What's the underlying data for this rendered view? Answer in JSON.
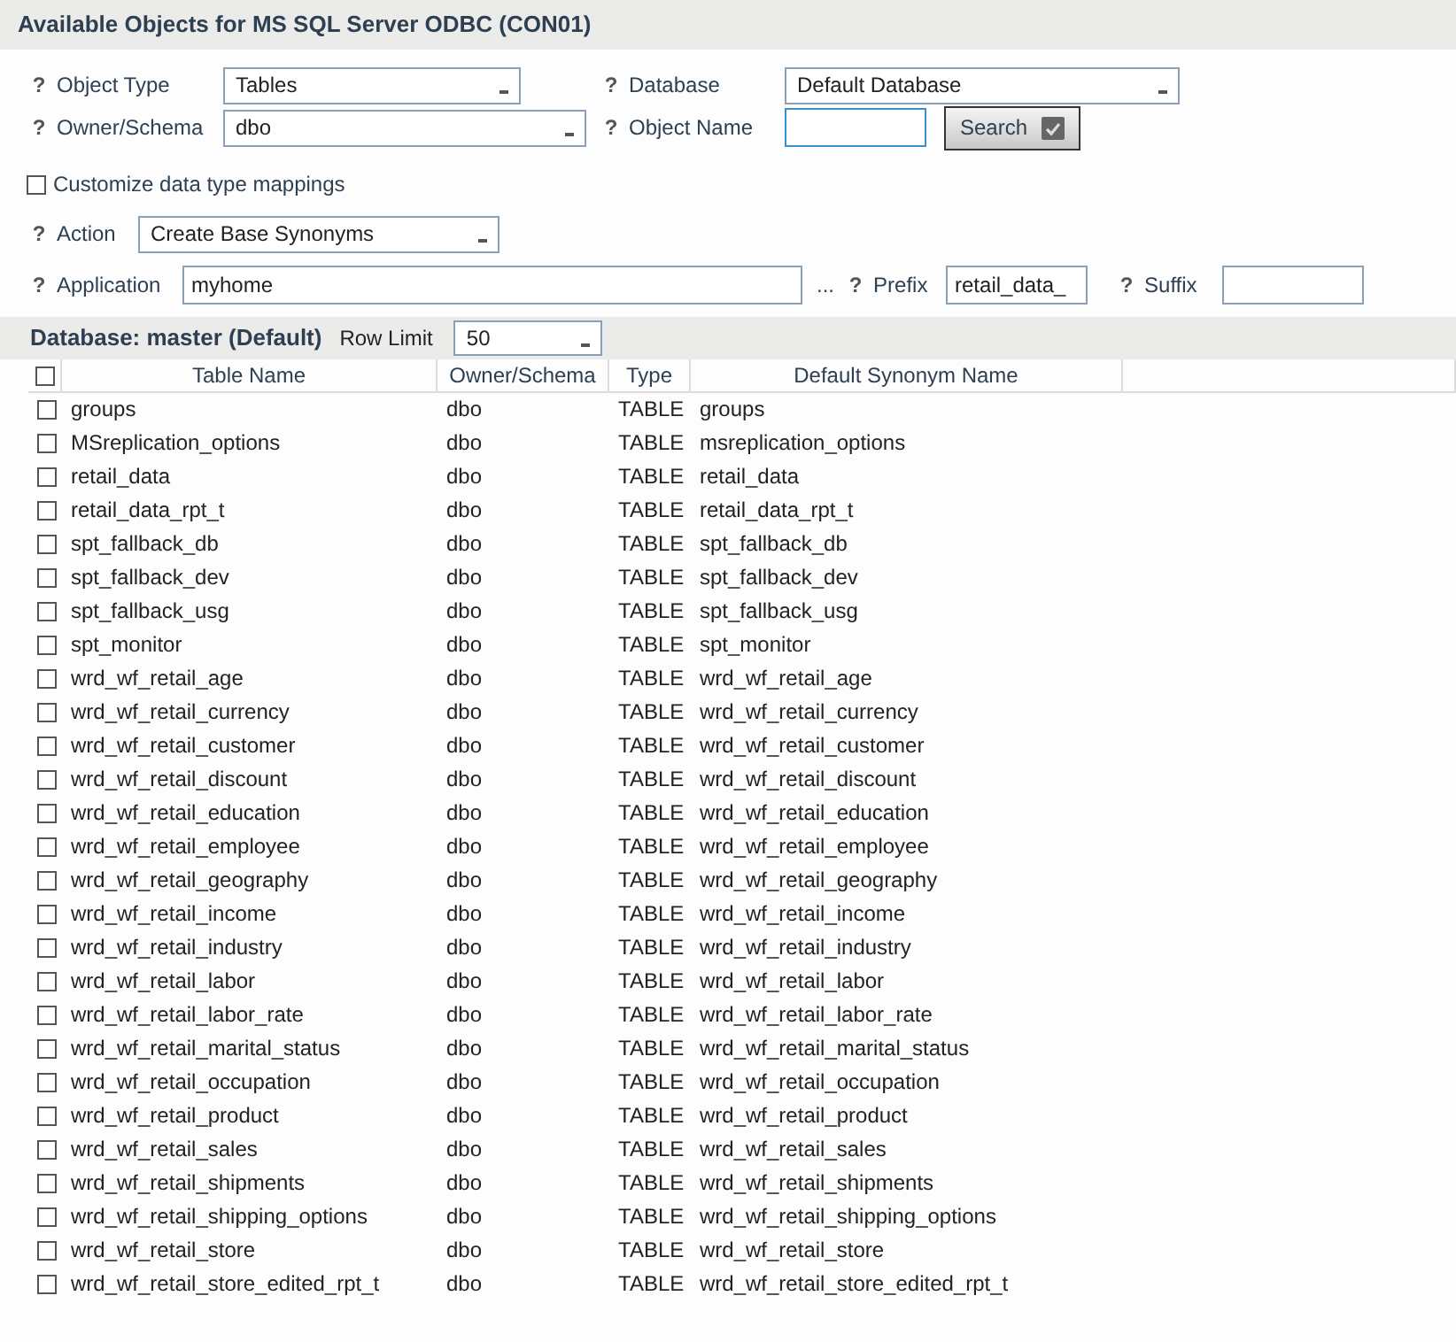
{
  "title": "Available Objects for MS SQL Server ODBC (CON01)",
  "form": {
    "help": "?",
    "object_type": {
      "label": "Object Type",
      "value": "Tables"
    },
    "database": {
      "label": "Database",
      "value": "Default Database"
    },
    "owner_schema": {
      "label": "Owner/Schema",
      "value": "dbo"
    },
    "object_name": {
      "label": "Object Name"
    },
    "search_button": {
      "label": "Search"
    },
    "customize": {
      "label": "Customize data type mappings",
      "checked": false
    },
    "action": {
      "label": "Action",
      "value": "Create Base Synonyms"
    },
    "application": {
      "label": "Application",
      "value": "myhome",
      "browse": "..."
    },
    "prefix": {
      "label": "Prefix",
      "value": "retail_data_"
    },
    "suffix": {
      "label": "Suffix"
    }
  },
  "results": {
    "title": "Database: master (Default)",
    "row_limit": {
      "label": "Row Limit",
      "value": "50"
    },
    "select_all": false,
    "columns": [
      "Table Name",
      "Owner/Schema",
      "Type",
      "Default Synonym Name"
    ],
    "rows": [
      {
        "checked": false,
        "cells": [
          "groups",
          "dbo",
          "TABLE",
          "groups"
        ]
      },
      {
        "checked": false,
        "cells": [
          "MSreplication_options",
          "dbo",
          "TABLE",
          "msreplication_options"
        ]
      },
      {
        "checked": false,
        "cells": [
          "retail_data",
          "dbo",
          "TABLE",
          "retail_data"
        ]
      },
      {
        "checked": false,
        "cells": [
          "retail_data_rpt_t",
          "dbo",
          "TABLE",
          "retail_data_rpt_t"
        ]
      },
      {
        "checked": false,
        "cells": [
          "spt_fallback_db",
          "dbo",
          "TABLE",
          "spt_fallback_db"
        ]
      },
      {
        "checked": false,
        "cells": [
          "spt_fallback_dev",
          "dbo",
          "TABLE",
          "spt_fallback_dev"
        ]
      },
      {
        "checked": false,
        "cells": [
          "spt_fallback_usg",
          "dbo",
          "TABLE",
          "spt_fallback_usg"
        ]
      },
      {
        "checked": false,
        "cells": [
          "spt_monitor",
          "dbo",
          "TABLE",
          "spt_monitor"
        ]
      },
      {
        "checked": false,
        "cells": [
          "wrd_wf_retail_age",
          "dbo",
          "TABLE",
          "wrd_wf_retail_age"
        ]
      },
      {
        "checked": false,
        "cells": [
          "wrd_wf_retail_currency",
          "dbo",
          "TABLE",
          "wrd_wf_retail_currency"
        ]
      },
      {
        "checked": false,
        "cells": [
          "wrd_wf_retail_customer",
          "dbo",
          "TABLE",
          "wrd_wf_retail_customer"
        ]
      },
      {
        "checked": false,
        "cells": [
          "wrd_wf_retail_discount",
          "dbo",
          "TABLE",
          "wrd_wf_retail_discount"
        ]
      },
      {
        "checked": false,
        "cells": [
          "wrd_wf_retail_education",
          "dbo",
          "TABLE",
          "wrd_wf_retail_education"
        ]
      },
      {
        "checked": false,
        "cells": [
          "wrd_wf_retail_employee",
          "dbo",
          "TABLE",
          "wrd_wf_retail_employee"
        ]
      },
      {
        "checked": false,
        "cells": [
          "wrd_wf_retail_geography",
          "dbo",
          "TABLE",
          "wrd_wf_retail_geography"
        ]
      },
      {
        "checked": false,
        "cells": [
          "wrd_wf_retail_income",
          "dbo",
          "TABLE",
          "wrd_wf_retail_income"
        ]
      },
      {
        "checked": false,
        "cells": [
          "wrd_wf_retail_industry",
          "dbo",
          "TABLE",
          "wrd_wf_retail_industry"
        ]
      },
      {
        "checked": false,
        "cells": [
          "wrd_wf_retail_labor",
          "dbo",
          "TABLE",
          "wrd_wf_retail_labor"
        ]
      },
      {
        "checked": false,
        "cells": [
          "wrd_wf_retail_labor_rate",
          "dbo",
          "TABLE",
          "wrd_wf_retail_labor_rate"
        ]
      },
      {
        "checked": false,
        "cells": [
          "wrd_wf_retail_marital_status",
          "dbo",
          "TABLE",
          "wrd_wf_retail_marital_status"
        ]
      },
      {
        "checked": false,
        "cells": [
          "wrd_wf_retail_occupation",
          "dbo",
          "TABLE",
          "wrd_wf_retail_occupation"
        ]
      },
      {
        "checked": false,
        "cells": [
          "wrd_wf_retail_product",
          "dbo",
          "TABLE",
          "wrd_wf_retail_product"
        ]
      },
      {
        "checked": false,
        "cells": [
          "wrd_wf_retail_sales",
          "dbo",
          "TABLE",
          "wrd_wf_retail_sales"
        ]
      },
      {
        "checked": false,
        "cells": [
          "wrd_wf_retail_shipments",
          "dbo",
          "TABLE",
          "wrd_wf_retail_shipments"
        ]
      },
      {
        "checked": false,
        "cells": [
          "wrd_wf_retail_shipping_options",
          "dbo",
          "TABLE",
          "wrd_wf_retail_shipping_options"
        ]
      },
      {
        "checked": false,
        "cells": [
          "wrd_wf_retail_store",
          "dbo",
          "TABLE",
          "wrd_wf_retail_store"
        ]
      },
      {
        "checked": false,
        "cells": [
          "wrd_wf_retail_store_edited_rpt_t",
          "dbo",
          "TABLE",
          "wrd_wf_retail_store_edited_rpt_t"
        ]
      }
    ]
  }
}
